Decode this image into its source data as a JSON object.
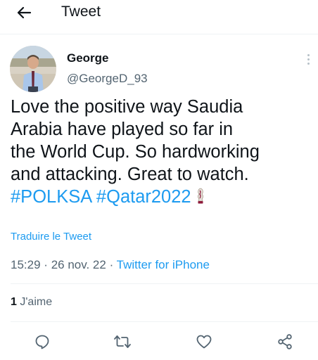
{
  "header": {
    "title": "Tweet",
    "back_icon": "arrow-left-icon"
  },
  "author": {
    "name": "George",
    "handle": "@GeorgeD_93",
    "avatar_icon": "profile-photo"
  },
  "tweet": {
    "text_lines": [
      "Love the positive way Saudia",
      "Arabia have played so far in",
      "the World Cup. So hardworking",
      "and attacking. Great to watch."
    ],
    "hashtags": [
      "#POLKSA",
      "#Qatar2022"
    ],
    "emoji_icon": "world-cup-trophy-icon"
  },
  "translate_label": "Traduire le Tweet",
  "meta": {
    "time": "15:29",
    "separator": "·",
    "date": "26 nov. 22",
    "source": "Twitter for iPhone"
  },
  "stats": {
    "likes_count": "1",
    "likes_label": "J'aime"
  },
  "actions": [
    "reply-icon",
    "retweet-icon",
    "like-icon",
    "share-icon"
  ],
  "colors": {
    "accent": "#1d9bf0",
    "text": "#0f1419",
    "secondary": "#536471",
    "divider": "#eff3f4"
  }
}
